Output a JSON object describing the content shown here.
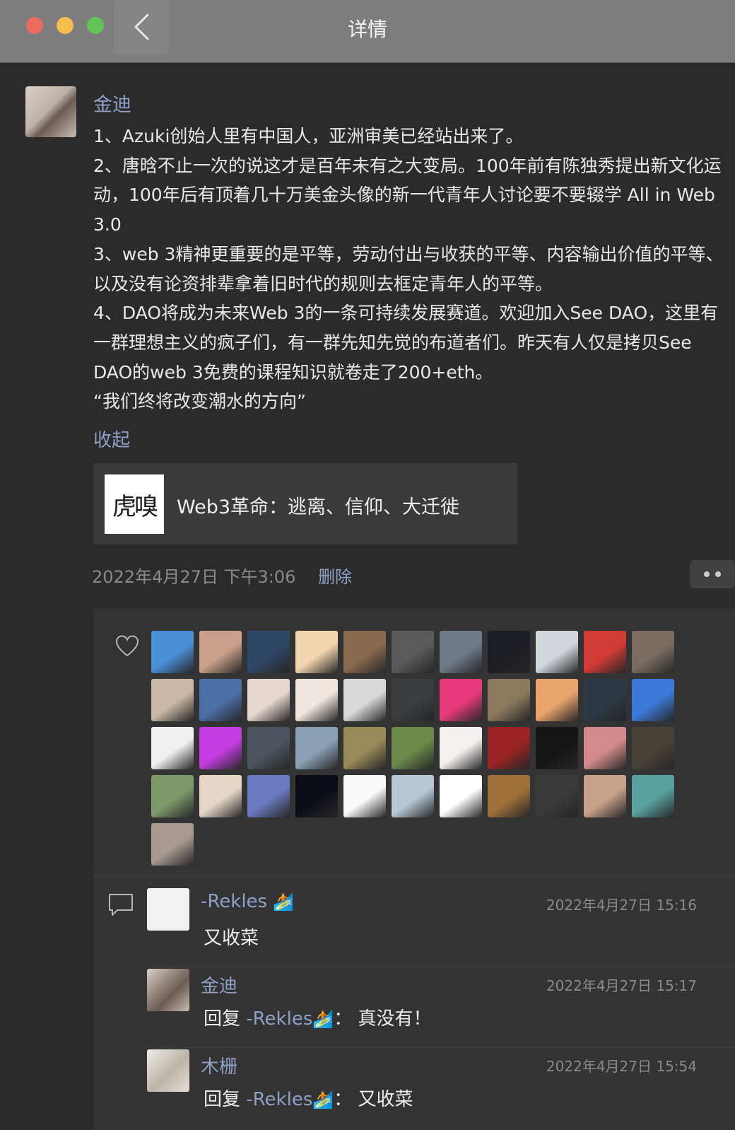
{
  "window": {
    "title": "详情"
  },
  "post": {
    "author": "金迪",
    "body": "1、Azuki创始人里有中国人，亚洲审美已经站出来了。\n2、唐晗不止一次的说这才是百年未有之大变局。100年前有陈独秀提出新文化运动，100年后有顶着几十万美金头像的新一代青年人讨论要不要辍学 All in Web 3.0\n3、web 3精神更重要的是平等，劳动付出与收获的平等、内容输出价值的平等、以及没有论资排辈拿着旧时代的规则去框定青年人的平等。\n4、DAO将成为未来Web 3的一条可持续发展赛道。欢迎加入See DAO，这里有一群理想主义的疯子们，有一群先知先觉的布道者们。昨天有人仅是拷贝See DAO的web 3免费的课程知识就卷走了200+eth。\n“我们终将改变潮水的方向”",
    "collapse_label": "收起",
    "link_card": {
      "thumb_text": "虎嗅",
      "title": "Web3革命：逃离、信仰、大迁徙"
    },
    "timestamp": "2022年4月27日 下午3:06",
    "delete_label": "删除"
  },
  "likes": {
    "avatar_colors": [
      "#4a90d9",
      "#c9a08a",
      "#2f4766",
      "#f3d6b0",
      "#8a6a4f",
      "#5a5a5a",
      "#6e7a88",
      "#1d1d24",
      "#cfd6dc",
      "#d23a35",
      "#7a6c60",
      "#c9b9a4",
      "#4d6fa8",
      "#e6d8cf",
      "#f0e6dd",
      "#d9d9d9",
      "#3b3e41",
      "#e83a7a",
      "#8c7a5e",
      "#e9a56c",
      "#2c3945",
      "#3c7ad9",
      "#f0f0f0",
      "#c43de0",
      "#4a5560",
      "#8aa0b5",
      "#9a8a5a",
      "#6b8a4a",
      "#f5f0f0",
      "#9b2323",
      "#151515",
      "#d28a8a",
      "#4a4236",
      "#7e9a6a",
      "#e5d7c8",
      "#6a7ac0",
      "#0d0d1a",
      "#fafafa",
      "#b8c9d6",
      "#ffffff",
      "#a0703a",
      "#3a3a3a",
      "#c9a28a",
      "#5aa0a0",
      "#a89a90"
    ]
  },
  "comments": [
    {
      "name": "-Rekles",
      "time": "2022年4月27日 15:16",
      "text": "又收菜",
      "avatar_color": "#f2f2f2"
    },
    {
      "name": "金迪",
      "time": "2022年4月27日 15:17",
      "reply_prefix": "回复",
      "reply_to": "-Rekles",
      "text": "真没有！",
      "avatar_color": "#b7a99c"
    },
    {
      "name": "木栅",
      "time": "2022年4月27日 15:54",
      "reply_prefix": "回复",
      "reply_to": "-Rekles",
      "text": "又收菜",
      "avatar_color": "#d7d1c7"
    }
  ],
  "colors": {
    "accent": "#8ea0c6",
    "background": "#2b2b2b",
    "panel": "#333333"
  }
}
